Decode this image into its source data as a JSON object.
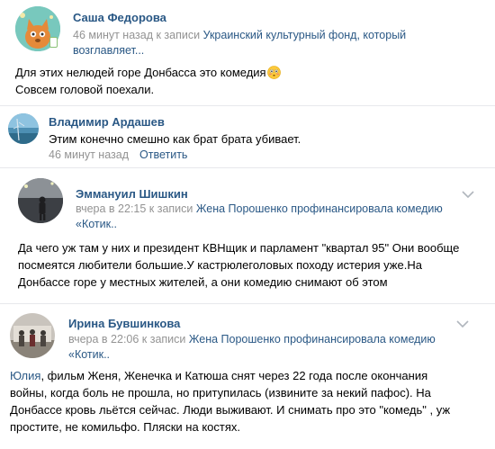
{
  "comments": [
    {
      "author": "Саша Федорова",
      "meta_time": "46 минут назад к записи ",
      "meta_link": "Украинский культурный фонд, который",
      "meta_link2": "возглавляет...",
      "text_line1": "Для этих нелюдей горе Донбасса это комедия",
      "text_line2": "Совсем головой поехали.",
      "emoji": "flushed-face-emoji"
    },
    {
      "author": "Владимир Ардашев",
      "text": "Этим конечно смешно как брат брата убивает.",
      "time": "46 минут назад",
      "reply_label": "Ответить"
    },
    {
      "author": "Эммануил Шишкин",
      "meta_time": "вчера в 22:15 к записи ",
      "meta_link": "Жена Порошенко профинансировала комедию",
      "meta_link2": "«Котик..",
      "text_line1": "Да чего уж там у них и президент КВНщик и парламент \"квартал 95\" Они вообще",
      "text_line2": "посмеятся любители большие.У кастрюлеголовых походу истерия уже.На",
      "text_line3": "Донбассе горе у местных жителей, а они комедию снимают об этом"
    },
    {
      "author": "Ирина Бувшинкова",
      "meta_time": "вчера в 22:06 к записи ",
      "meta_link": "Жена Порошенко профинансировала комедию",
      "meta_link2": "«Котик..",
      "mention": "Юлия",
      "text_line1": ", фильм Женя, Женечка и Катюша снят через 22 года после окончания",
      "text_line2": "войны, когда боль не прошла, но притупилась (извините за некий пафос). На",
      "text_line3": "Донбассе кровь льётся сейчас. Люди выживают. И снимать про это \"комедь\" , уж",
      "text_line4": "простите, не комильфо. Пляски на костях."
    }
  ],
  "colors": {
    "link": "#2a5885",
    "meta": "#939393",
    "divider": "#e7e8ec",
    "online": "#8ac176"
  }
}
